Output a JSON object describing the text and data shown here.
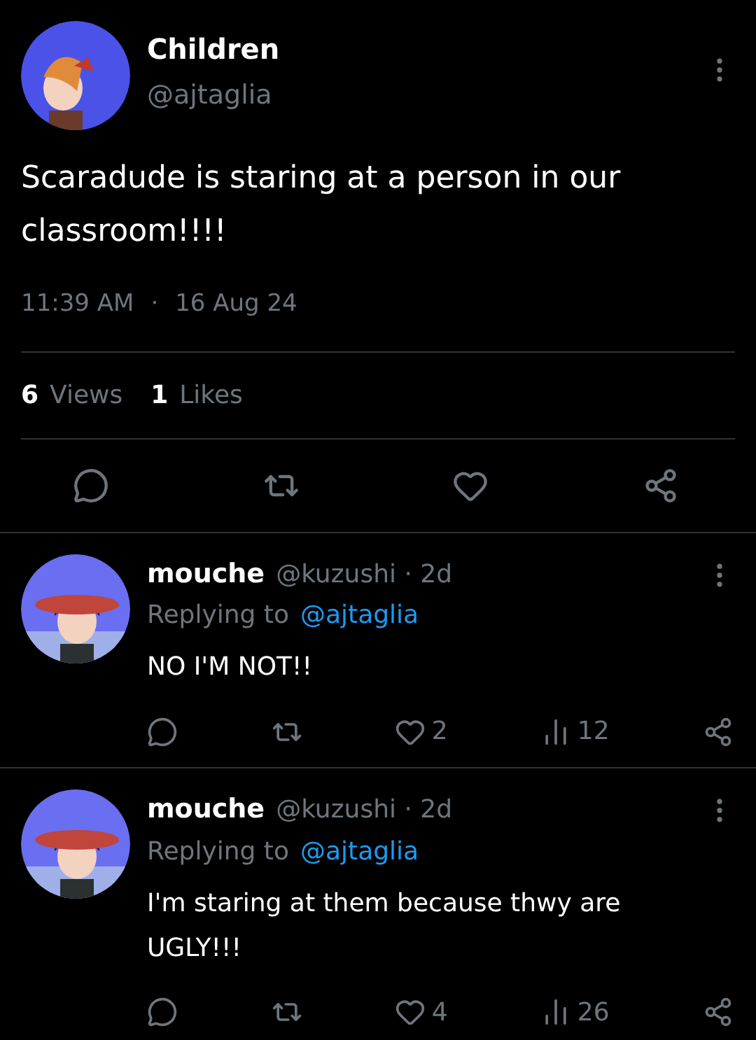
{
  "tweet": {
    "name": "Children",
    "handle": "@ajtaglia",
    "text": "Scaradude is staring at a person in our classroom!!!!",
    "time": "11:39 AM",
    "separator": "·",
    "date": "16 Aug 24",
    "stats": [
      {
        "count": "6",
        "label": "Views"
      },
      {
        "count": "1",
        "label": "Likes"
      }
    ]
  },
  "replies": [
    {
      "name": "mouche",
      "handle": "@kuzushi · 2d",
      "replying_label": "Replying to",
      "replying_to": "@ajtaglia",
      "text": "NO I'M NOT!!",
      "likes": "2",
      "views": "12"
    },
    {
      "name": "mouche",
      "handle": "@kuzushi · 2d",
      "replying_label": "Replying to",
      "replying_to": "@ajtaglia",
      "text": "I'm staring at them because thwy are UGLY!!!",
      "likes": "4",
      "views": "26"
    }
  ]
}
